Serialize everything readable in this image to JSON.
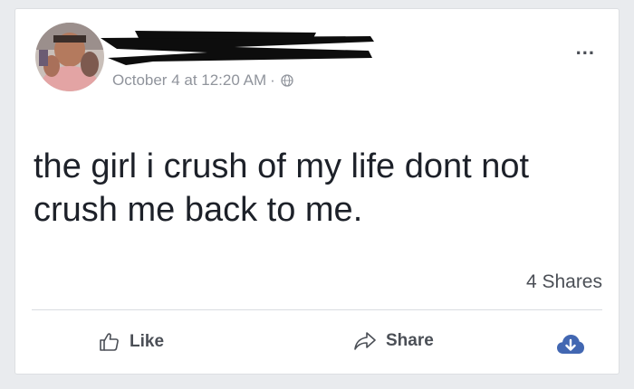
{
  "post": {
    "author_name": "",
    "timestamp": "October 4 at 12:20 AM",
    "separator": "·",
    "privacy_icon": "globe-icon",
    "more_options": "...",
    "text": "the girl i crush of my life dont not crush me back to me.",
    "shares": "4 Shares"
  },
  "actions": {
    "like_label": "Like",
    "share_label": "Share",
    "download_icon": "cloud-download-icon"
  },
  "colors": {
    "meta_text": "#90949c",
    "body_text": "#1d2129",
    "action_text": "#4b4f56",
    "accent_blue": "#4267b2",
    "background": "#e9ebee"
  }
}
